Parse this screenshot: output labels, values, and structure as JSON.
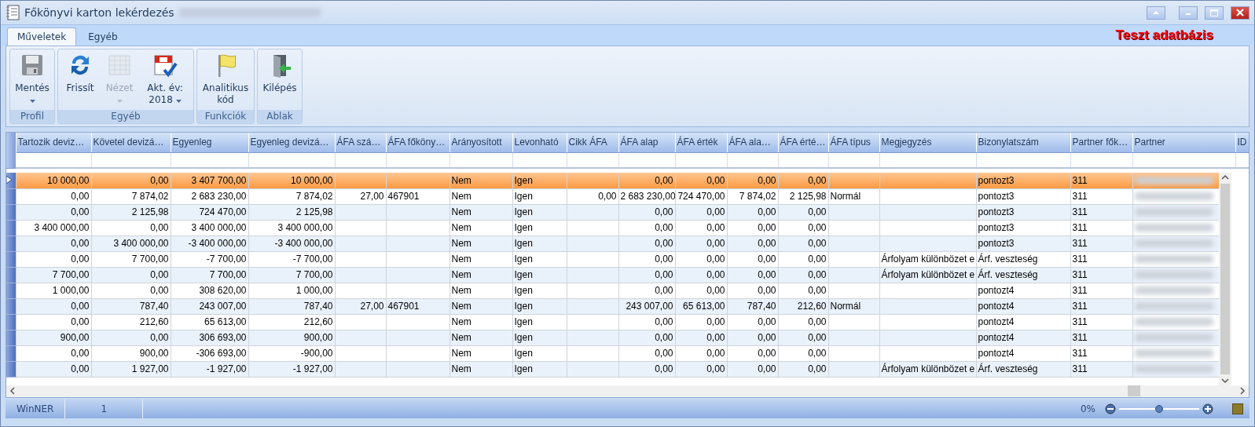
{
  "window": {
    "title": "Főkönyvi karton lekérdezés"
  },
  "tabs": [
    {
      "label": "Műveletek",
      "selected": true
    },
    {
      "label": "Egyéb",
      "selected": false
    }
  ],
  "badge": "Teszt adatbázis",
  "ribbon_groups": [
    {
      "label": "Profil",
      "buttons": [
        {
          "label": "Mentés",
          "disabled": false,
          "dropdown": true
        }
      ]
    },
    {
      "label": "Egyéb",
      "buttons": [
        {
          "label": "Frissít",
          "disabled": false,
          "dropdown": false
        },
        {
          "label": "Nézet",
          "disabled": true,
          "dropdown": true
        },
        {
          "label": "Akt. év:",
          "label2": "2018",
          "disabled": false,
          "dropdown": true
        }
      ]
    },
    {
      "label": "Funkciók",
      "buttons": [
        {
          "label": "Analitikus",
          "label2": "kód",
          "disabled": false,
          "dropdown": false
        }
      ]
    },
    {
      "label": "Ablak",
      "buttons": [
        {
          "label": "Kilépés",
          "disabled": false,
          "dropdown": false
        }
      ]
    }
  ],
  "table": {
    "columns": [
      {
        "label": "Tartozik deviz…"
      },
      {
        "label": "Követel devizá…"
      },
      {
        "label": "Egyenleg"
      },
      {
        "label": "Egyenleg devizá…"
      },
      {
        "label": "ÁFA szá…"
      },
      {
        "label": "ÁFA főköny…"
      },
      {
        "label": "Arányosított"
      },
      {
        "label": "Levonható"
      },
      {
        "label": "Cikk ÁFA"
      },
      {
        "label": "ÁFA alap"
      },
      {
        "label": "ÁFA érték"
      },
      {
        "label": "ÁFA ala…"
      },
      {
        "label": "ÁFA érté…"
      },
      {
        "label": "ÁFA típus"
      },
      {
        "label": "Megjegyzés"
      },
      {
        "label": "Bizonylatszám"
      },
      {
        "label": "Partner fők…"
      },
      {
        "label": "Partner"
      },
      {
        "label": "ID"
      }
    ],
    "rows": [
      {
        "selected": true,
        "cells": [
          "10 000,00",
          "0,00",
          "3 407 700,00",
          "10 000,00",
          null,
          null,
          "Nem",
          "Igen",
          null,
          "0,00",
          "0,00",
          "0,00",
          "0,00",
          null,
          null,
          "pontozt3",
          "311"
        ]
      },
      {
        "selected": false,
        "cells": [
          "0,00",
          "7 874,02",
          "2 683 230,00",
          "7 874,02",
          "27,00",
          "467901",
          "Nem",
          "Igen",
          "0,00",
          "2 683 230,00",
          "724 470,00",
          "7 874,02",
          "2 125,98",
          "Normál",
          null,
          "pontozt3",
          "311"
        ]
      },
      {
        "selected": false,
        "cells": [
          "0,00",
          "2 125,98",
          "724 470,00",
          "2 125,98",
          null,
          null,
          "Nem",
          "Igen",
          null,
          "0,00",
          "0,00",
          "0,00",
          "0,00",
          null,
          null,
          "pontozt3",
          "311"
        ]
      },
      {
        "selected": false,
        "cells": [
          "3 400 000,00",
          "0,00",
          "3 400 000,00",
          "3 400 000,00",
          null,
          null,
          "Nem",
          "Igen",
          null,
          "0,00",
          "0,00",
          "0,00",
          "0,00",
          null,
          null,
          "pontozt3",
          "311"
        ]
      },
      {
        "selected": false,
        "cells": [
          "0,00",
          "3 400 000,00",
          "-3 400 000,00",
          "-3 400 000,00",
          null,
          null,
          "Nem",
          "Igen",
          null,
          "0,00",
          "0,00",
          "0,00",
          "0,00",
          null,
          null,
          "pontozt3",
          "311"
        ]
      },
      {
        "selected": false,
        "cells": [
          "0,00",
          "7 700,00",
          "-7 700,00",
          "-7 700,00",
          null,
          null,
          "Nem",
          "Igen",
          null,
          "0,00",
          "0,00",
          "0,00",
          "0,00",
          null,
          "Árfolyam különbözet e",
          "Árf. veszteség",
          "311"
        ]
      },
      {
        "selected": false,
        "cells": [
          "7 700,00",
          "0,00",
          "7 700,00",
          "7 700,00",
          null,
          null,
          "Nem",
          "Igen",
          null,
          "0,00",
          "0,00",
          "0,00",
          "0,00",
          null,
          "Árfolyam különbözet e",
          "Árf. veszteség",
          "311"
        ]
      },
      {
        "selected": false,
        "cells": [
          "1 000,00",
          "0,00",
          "308 620,00",
          "1 000,00",
          null,
          null,
          "Nem",
          "Igen",
          null,
          "0,00",
          "0,00",
          "0,00",
          "0,00",
          null,
          null,
          "pontozt4",
          "311"
        ]
      },
      {
        "selected": false,
        "cells": [
          "0,00",
          "787,40",
          "243 007,00",
          "787,40",
          "27,00",
          "467901",
          "Nem",
          "Igen",
          null,
          "243 007,00",
          "65 613,00",
          "787,40",
          "212,60",
          "Normál",
          null,
          "pontozt4",
          "311"
        ]
      },
      {
        "selected": false,
        "cells": [
          "0,00",
          "212,60",
          "65 613,00",
          "212,60",
          null,
          null,
          "Nem",
          "Igen",
          null,
          "0,00",
          "0,00",
          "0,00",
          "0,00",
          null,
          null,
          "pontozt4",
          "311"
        ]
      },
      {
        "selected": false,
        "cells": [
          "900,00",
          "0,00",
          "306 693,00",
          "900,00",
          null,
          null,
          "Nem",
          "Igen",
          null,
          "0,00",
          "0,00",
          "0,00",
          "0,00",
          null,
          null,
          "pontozt4",
          "311"
        ]
      },
      {
        "selected": false,
        "cells": [
          "0,00",
          "900,00",
          "-306 693,00",
          "-900,00",
          null,
          null,
          "Nem",
          "Igen",
          null,
          "0,00",
          "0,00",
          "0,00",
          "0,00",
          null,
          null,
          "pontozt4",
          "311"
        ]
      },
      {
        "selected": false,
        "cells": [
          "0,00",
          "1 927,00",
          "-1 927,00",
          "-1 927,00",
          null,
          null,
          "Nem",
          "Igen",
          null,
          "0,00",
          "0,00",
          "0,00",
          "0,00",
          null,
          "Árfolyam különbözet e",
          "Árf. veszteség",
          "311"
        ]
      }
    ]
  },
  "status_bar": {
    "items": [
      "WinNER",
      "1"
    ],
    "zoom": "0%",
    "zoom_slider": {
      "level": 0.5
    }
  }
}
